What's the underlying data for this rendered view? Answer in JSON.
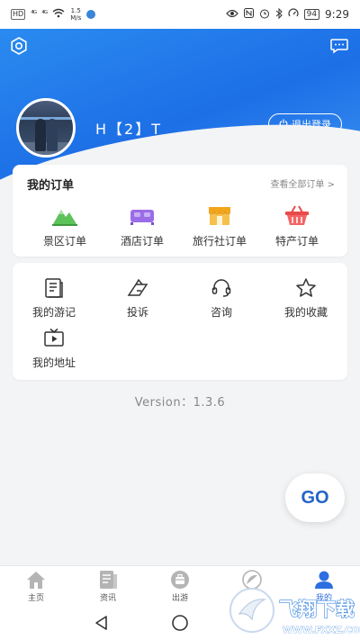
{
  "status_bar": {
    "hd_tag": "HD",
    "signal1": "⁴ᴳ",
    "signal2": "⁴ᴳ",
    "speed_value": "1.5",
    "speed_unit": "M/s",
    "battery": "94",
    "time": "9:29"
  },
  "header": {
    "username": "H【2】T",
    "logout_label": "退出登录"
  },
  "orders": {
    "title": "我的订单",
    "view_all": "查看全部订单 >",
    "items": [
      {
        "label": "景区订单",
        "icon": "mountain-icon",
        "color": "#5cc25a"
      },
      {
        "label": "酒店订单",
        "icon": "bed-icon",
        "color": "#9b6ce8"
      },
      {
        "label": "旅行社订单",
        "icon": "shop-icon",
        "color": "#f2a51c"
      },
      {
        "label": "特产订单",
        "icon": "basket-icon",
        "color": "#ea4a4a"
      }
    ]
  },
  "menu": {
    "items": [
      {
        "label": "我的游记",
        "icon": "journal-icon"
      },
      {
        "label": "投诉",
        "icon": "complaint-icon"
      },
      {
        "label": "咨询",
        "icon": "headset-icon"
      },
      {
        "label": "我的收藏",
        "icon": "star-icon"
      },
      {
        "label": "我的地址",
        "icon": "tv-icon"
      }
    ]
  },
  "version": "Version：1.3.6",
  "go_label": "GO",
  "tabbar": {
    "items": [
      {
        "label": "主页",
        "icon": "home-icon"
      },
      {
        "label": "资讯",
        "icon": "news-icon"
      },
      {
        "label": "出游",
        "icon": "travel-icon"
      },
      {
        "label": "",
        "icon": "compass-icon"
      },
      {
        "label": "我的",
        "icon": "user-icon",
        "active": true
      }
    ]
  },
  "watermark": {
    "text": "飞翔下载",
    "url": "WWW.FXXZ.COM"
  },
  "colors": {
    "brand_blue": "#1d6fe6",
    "active_tab": "#2d6fe0",
    "go_text": "#2464c8"
  }
}
